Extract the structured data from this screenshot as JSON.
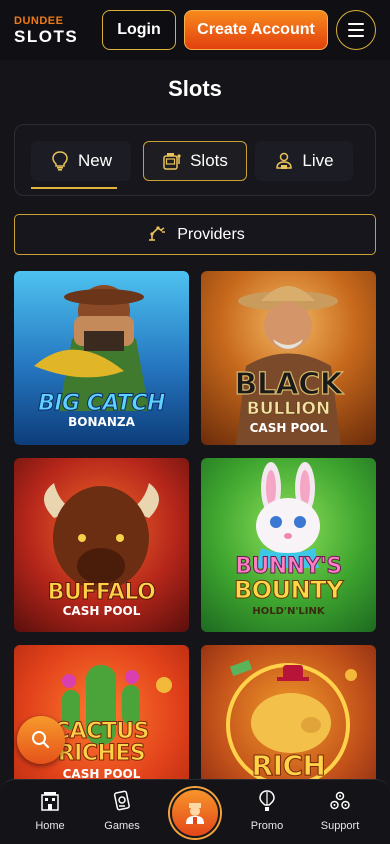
{
  "brand": {
    "logo_top": "DUNDEE",
    "logo_bottom": "SLOTS"
  },
  "header": {
    "login_label": "Login",
    "create_label": "Create Account",
    "menu_icon": "hamburger-icon"
  },
  "page": {
    "title": "Slots"
  },
  "tabs": [
    {
      "label": "New",
      "icon": "lightbulb-icon",
      "active_underline": true
    },
    {
      "label": "Slots",
      "icon": "slot-machine-icon",
      "selected": true
    },
    {
      "label": "Live",
      "icon": "dealer-icon"
    }
  ],
  "providers": {
    "label": "Providers",
    "icon": "robot-arm-icon"
  },
  "games": [
    {
      "line1": "BIG CATCH",
      "line2": "BONANZA"
    },
    {
      "line1": "BLACK",
      "line2": "BULLION",
      "line3": "CASH POOL"
    },
    {
      "line1": "BUFFALO",
      "line2": "CASH POOL"
    },
    {
      "line1": "BUNNY'S",
      "line2": "BOUNTY",
      "line3": "HOLD'N'LINK"
    },
    {
      "line1": "CACTUS",
      "line2": "RICHES",
      "line3": "CASH POOL"
    },
    {
      "line1": "RICH"
    }
  ],
  "bottom_nav": {
    "home": "Home",
    "games": "Games",
    "promo": "Promo",
    "support": "Support"
  },
  "colors": {
    "accent_gold": "#c9a236",
    "accent_orange": "#f07a16",
    "background": "#141419"
  }
}
